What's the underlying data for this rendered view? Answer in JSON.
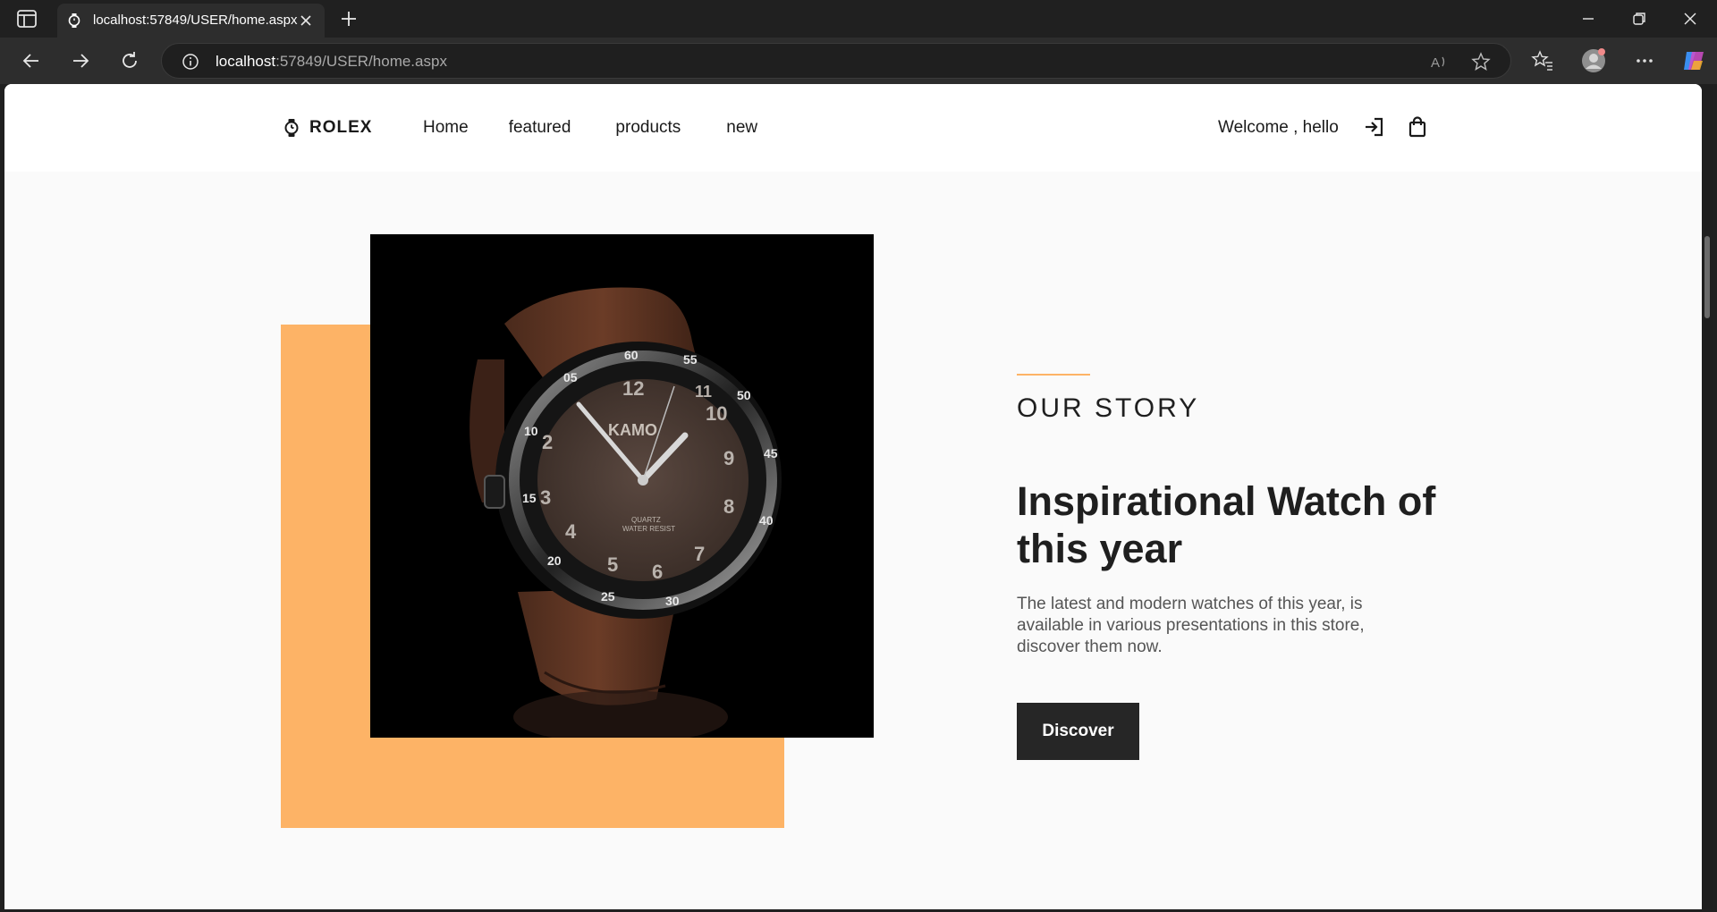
{
  "browser": {
    "tab_title": "localhost:57849/USER/home.aspx",
    "url_host": "localhost",
    "url_rest": ":57849/USER/home.aspx"
  },
  "site": {
    "logo_text": "ROLEX",
    "nav": [
      "Home",
      "featured",
      "products",
      "new"
    ],
    "welcome_text": "Welcome , hello"
  },
  "hero": {
    "eyebrow": "OUR STORY",
    "headline": "Inspirational Watch of this year",
    "description": "The latest and modern watches of this year, is available in various presentations in this store, discover them now.",
    "button_label": "Discover",
    "accent_color": "#fdb366",
    "button_color": "#262626"
  },
  "watch_dial": {
    "brand": "KAMO",
    "text_lines": [
      "QUARTZ",
      "WATER RESIST"
    ]
  }
}
